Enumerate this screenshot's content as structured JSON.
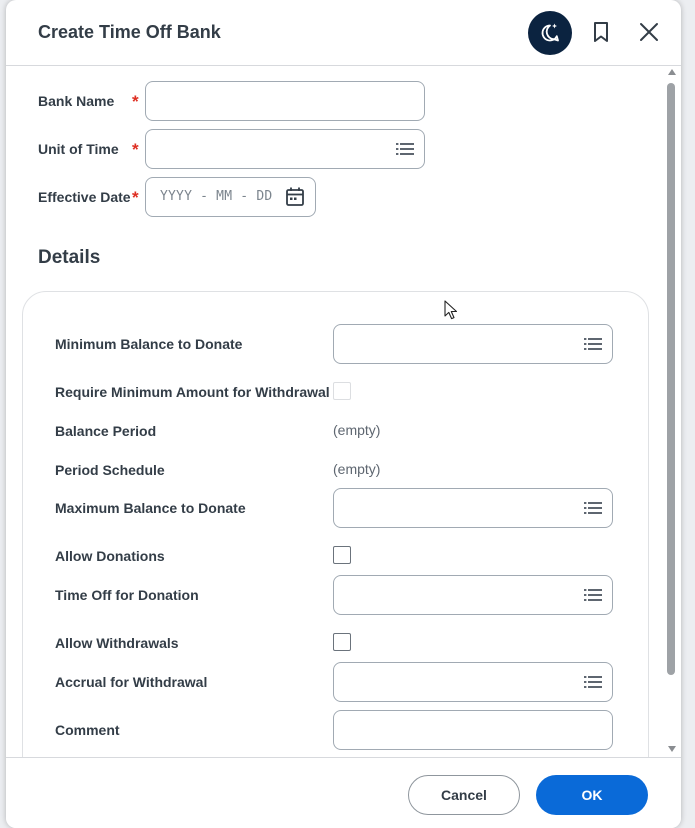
{
  "dialog": {
    "title": "Create Time Off Bank"
  },
  "header_icons": {
    "assistant": "sparkle-chat-icon",
    "bookmark": "bookmark-icon",
    "close": "close-icon"
  },
  "fields": {
    "bank_name": {
      "label": "Bank Name",
      "required_mark": "*",
      "value": ""
    },
    "unit_of_time": {
      "label": "Unit of Time",
      "required_mark": "*",
      "value": ""
    },
    "effective_date": {
      "label": "Effective Date",
      "required_mark": "*",
      "placeholder": "YYYY - MM - DD"
    }
  },
  "details": {
    "title": "Details",
    "minimum_balance": {
      "label": "Minimum Balance to Donate"
    },
    "require_minimum": {
      "label": "Require Minimum Amount for Withdrawal",
      "checked": false,
      "disabled": true
    },
    "balance_period": {
      "label": "Balance Period",
      "value": "(empty)"
    },
    "period_schedule": {
      "label": "Period Schedule",
      "value": "(empty)"
    },
    "maximum_balance": {
      "label": "Maximum Balance to Donate"
    },
    "allow_donations": {
      "label": "Allow Donations",
      "checked": false
    },
    "time_off_for_donation": {
      "label": "Time Off for Donation"
    },
    "allow_withdrawals": {
      "label": "Allow Withdrawals",
      "checked": false
    },
    "accrual_for_withdrawal": {
      "label": "Accrual for Withdrawal"
    },
    "comment": {
      "label": "Comment",
      "value": ""
    }
  },
  "footer": {
    "cancel_label": "Cancel",
    "ok_label": "OK"
  },
  "colors": {
    "primary": "#0a6ad8",
    "assistant_bg": "#0b2340",
    "required": "#de2e21",
    "text": "#333d47"
  }
}
